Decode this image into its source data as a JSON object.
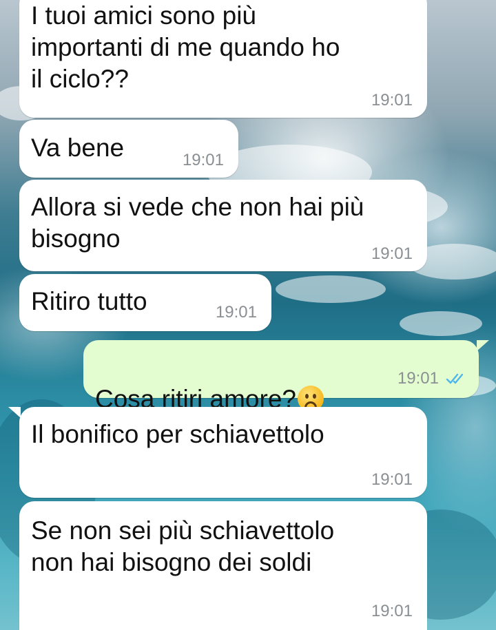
{
  "chat": {
    "messages": [
      {
        "direction": "incoming",
        "text": "I tuoi amici sono più\nimportanti di me quando ho\nil ciclo??",
        "time": "19:01"
      },
      {
        "direction": "incoming",
        "text": "Va bene",
        "time": "19:01"
      },
      {
        "direction": "incoming",
        "text": "Allora si vede che non hai più\nbisogno",
        "time": "19:01"
      },
      {
        "direction": "incoming",
        "text": "Ritiro tutto",
        "time": "19:01"
      },
      {
        "direction": "outgoing",
        "text": "Cosa ritiri amore?",
        "emoji": "sad-face-emoji",
        "time": "19:01",
        "status": "read",
        "status_icon": "double-check-icon"
      },
      {
        "direction": "incoming",
        "text": "Il bonifico per schiavettolo",
        "time": "19:01"
      },
      {
        "direction": "incoming",
        "text": "Se non sei più schiavettolo\nnon hai bisogno dei soldi",
        "time": "19:01"
      }
    ]
  },
  "colors": {
    "incoming_bubble": "#ffffff",
    "outgoing_bubble": "#e3fdd0",
    "read_ticks": "#4fb6ec",
    "timestamp": "#8a8f93"
  }
}
